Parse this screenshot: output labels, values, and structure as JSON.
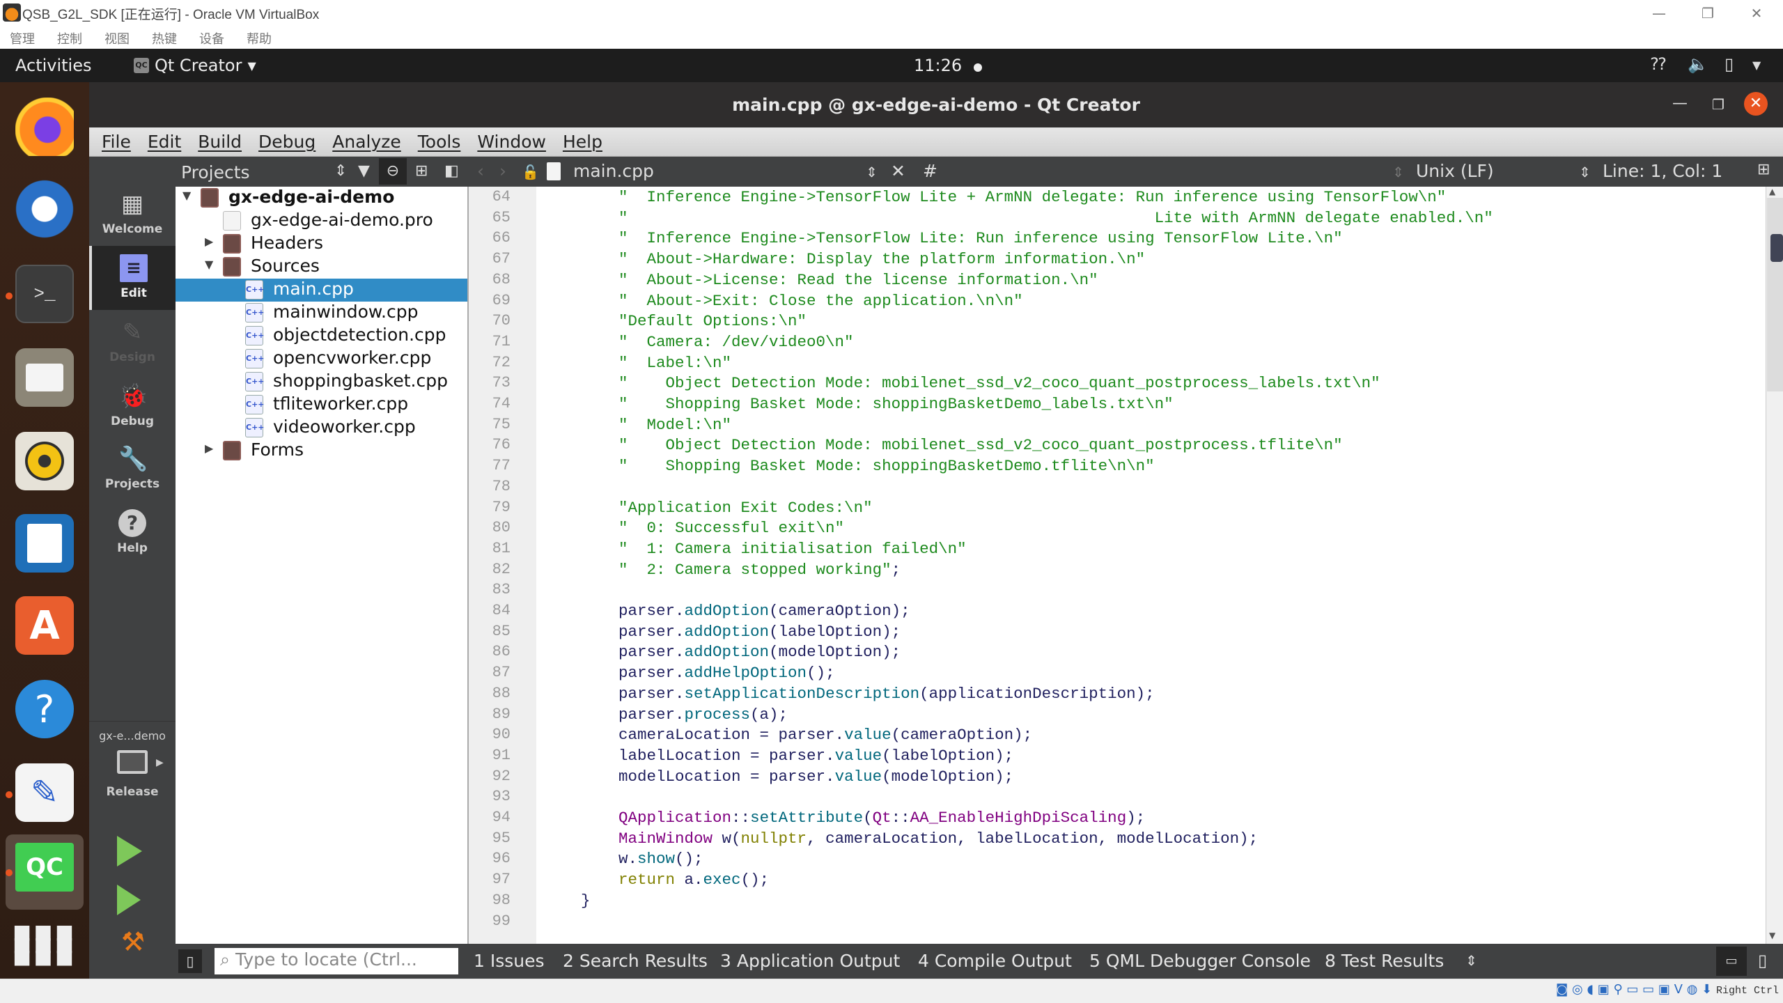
{
  "host": {
    "title": "QSB_G2L_SDK [正在运行] - Oracle VM VirtualBox",
    "menu": [
      "管理",
      "控制",
      "视图",
      "热键",
      "设备",
      "帮助"
    ],
    "host_key": "Right Ctrl"
  },
  "topbar": {
    "activities": "Activities",
    "app_name": "Qt Creator",
    "clock": "11:26"
  },
  "dock": {
    "apps": [
      {
        "name": "Firefox",
        "running": false
      },
      {
        "name": "Thunderbird",
        "running": false
      },
      {
        "name": "Terminal",
        "running": true
      },
      {
        "name": "Files",
        "running": false
      },
      {
        "name": "Rhythmbox",
        "running": false
      },
      {
        "name": "LibreOffice Writer",
        "running": false
      },
      {
        "name": "Ubuntu Software",
        "running": false
      },
      {
        "name": "Help",
        "running": false
      },
      {
        "name": "Text Editor",
        "running": true
      },
      {
        "name": "Qt Creator",
        "running": true
      }
    ]
  },
  "window": {
    "title": "main.cpp @ gx-edge-ai-demo - Qt Creator",
    "menu": [
      "File",
      "Edit",
      "Build",
      "Debug",
      "Analyze",
      "Tools",
      "Window",
      "Help"
    ]
  },
  "modes": [
    {
      "label": "Welcome",
      "state": "normal"
    },
    {
      "label": "Edit",
      "state": "active"
    },
    {
      "label": "Design",
      "state": "disabled"
    },
    {
      "label": "Debug",
      "state": "normal"
    },
    {
      "label": "Projects",
      "state": "normal"
    },
    {
      "label": "Help",
      "state": "normal"
    }
  ],
  "kit": {
    "project": "gx-e...demo",
    "build_config": "Release"
  },
  "projects": {
    "header": "Projects",
    "tree": [
      {
        "label": "gx-edge-ai-demo",
        "level": 0,
        "expanded": true,
        "type": "project"
      },
      {
        "label": "gx-edge-ai-demo.pro",
        "level": 1,
        "type": "pro"
      },
      {
        "label": "Headers",
        "level": 1,
        "expanded": false,
        "type": "folder-h"
      },
      {
        "label": "Sources",
        "level": 1,
        "expanded": true,
        "type": "folder-cpp"
      },
      {
        "label": "main.cpp",
        "level": 2,
        "type": "cpp",
        "selected": true
      },
      {
        "label": "mainwindow.cpp",
        "level": 2,
        "type": "cpp"
      },
      {
        "label": "objectdetection.cpp",
        "level": 2,
        "type": "cpp"
      },
      {
        "label": "opencvworker.cpp",
        "level": 2,
        "type": "cpp"
      },
      {
        "label": "shoppingbasket.cpp",
        "level": 2,
        "type": "cpp"
      },
      {
        "label": "tfliteworker.cpp",
        "level": 2,
        "type": "cpp"
      },
      {
        "label": "videoworker.cpp",
        "level": 2,
        "type": "cpp"
      },
      {
        "label": "Forms",
        "level": 1,
        "expanded": false,
        "type": "folder-ui"
      }
    ]
  },
  "editor": {
    "file": "main.cpp",
    "symbol": "#",
    "line_endings": "Unix (LF)",
    "cursor": "Line: 1, Col: 1",
    "lines": [
      {
        "n": 64,
        "parts": [
          [
            "str",
            "    \"  Inference Engine->TensorFlow Lite + ArmNN delegate: Run inference using TensorFlow\\n\""
          ]
        ]
      },
      {
        "n": 65,
        "parts": [
          [
            "str",
            "    \"                                                        Lite with ArmNN delegate enabled.\\n\""
          ]
        ]
      },
      {
        "n": 66,
        "parts": [
          [
            "str",
            "    \"  Inference Engine->TensorFlow Lite: Run inference using TensorFlow Lite.\\n\""
          ]
        ]
      },
      {
        "n": 67,
        "parts": [
          [
            "str",
            "    \"  About->Hardware: Display the platform information.\\n\""
          ]
        ]
      },
      {
        "n": 68,
        "parts": [
          [
            "str",
            "    \"  About->License: Read the license information.\\n\""
          ]
        ]
      },
      {
        "n": 69,
        "parts": [
          [
            "str",
            "    \"  About->Exit: Close the application.\\n\\n\""
          ]
        ]
      },
      {
        "n": 70,
        "parts": [
          [
            "str",
            "    \"Default Options:\\n\""
          ]
        ]
      },
      {
        "n": 71,
        "parts": [
          [
            "str",
            "    \"  Camera: /dev/video0\\n\""
          ]
        ]
      },
      {
        "n": 72,
        "parts": [
          [
            "str",
            "    \"  Label:\\n\""
          ]
        ]
      },
      {
        "n": 73,
        "parts": [
          [
            "str",
            "    \"    Object Detection Mode: mobilenet_ssd_v2_coco_quant_postprocess_labels.txt\\n\""
          ]
        ]
      },
      {
        "n": 74,
        "parts": [
          [
            "str",
            "    \"    Shopping Basket Mode: shoppingBasketDemo_labels.txt\\n\""
          ]
        ]
      },
      {
        "n": 75,
        "parts": [
          [
            "str",
            "    \"  Model:\\n\""
          ]
        ]
      },
      {
        "n": 76,
        "parts": [
          [
            "str",
            "    \"    Object Detection Mode: mobilenet_ssd_v2_coco_quant_postprocess.tflite\\n\""
          ]
        ]
      },
      {
        "n": 77,
        "parts": [
          [
            "str",
            "    \"    Shopping Basket Mode: shoppingBasketDemo.tflite\\n\\n\""
          ]
        ]
      },
      {
        "n": 78,
        "parts": []
      },
      {
        "n": 79,
        "parts": [
          [
            "str",
            "    \"Application Exit Codes:\\n\""
          ]
        ]
      },
      {
        "n": 80,
        "parts": [
          [
            "str",
            "    \"  0: Successful exit\\n\""
          ]
        ]
      },
      {
        "n": 81,
        "parts": [
          [
            "str",
            "    \"  1: Camera initialisation failed\\n\""
          ]
        ]
      },
      {
        "n": 82,
        "parts": [
          [
            "str",
            "    \"  2: Camera stopped working\""
          ],
          [
            "pl",
            ";"
          ]
        ]
      },
      {
        "n": 83,
        "parts": []
      },
      {
        "n": 84,
        "parts": [
          [
            "pl",
            "    parser."
          ],
          [
            "fn",
            "addOption"
          ],
          [
            "pl",
            "(cameraOption);"
          ]
        ]
      },
      {
        "n": 85,
        "parts": [
          [
            "pl",
            "    parser."
          ],
          [
            "fn",
            "addOption"
          ],
          [
            "pl",
            "(labelOption);"
          ]
        ]
      },
      {
        "n": 86,
        "parts": [
          [
            "pl",
            "    parser."
          ],
          [
            "fn",
            "addOption"
          ],
          [
            "pl",
            "(modelOption);"
          ]
        ]
      },
      {
        "n": 87,
        "parts": [
          [
            "pl",
            "    parser."
          ],
          [
            "fn",
            "addHelpOption"
          ],
          [
            "pl",
            "();"
          ]
        ]
      },
      {
        "n": 88,
        "parts": [
          [
            "pl",
            "    parser."
          ],
          [
            "fn",
            "setApplicationDescription"
          ],
          [
            "pl",
            "(applicationDescription);"
          ]
        ]
      },
      {
        "n": 89,
        "parts": [
          [
            "pl",
            "    parser."
          ],
          [
            "fn",
            "process"
          ],
          [
            "pl",
            "(a);"
          ]
        ]
      },
      {
        "n": 90,
        "parts": [
          [
            "pl",
            "    cameraLocation = parser."
          ],
          [
            "fn",
            "value"
          ],
          [
            "pl",
            "(cameraOption);"
          ]
        ]
      },
      {
        "n": 91,
        "parts": [
          [
            "pl",
            "    labelLocation = parser."
          ],
          [
            "fn",
            "value"
          ],
          [
            "pl",
            "(labelOption);"
          ]
        ]
      },
      {
        "n": 92,
        "parts": [
          [
            "pl",
            "    modelLocation = parser."
          ],
          [
            "fn",
            "value"
          ],
          [
            "pl",
            "(modelOption);"
          ]
        ]
      },
      {
        "n": 93,
        "parts": []
      },
      {
        "n": 94,
        "parts": [
          [
            "typ",
            "    QApplication"
          ],
          [
            "pl",
            "::"
          ],
          [
            "fn",
            "setAttribute"
          ],
          [
            "pl",
            "("
          ],
          [
            "typ",
            "Qt"
          ],
          [
            "pl",
            "::"
          ],
          [
            "typ",
            "AA_EnableHighDpiScaling"
          ],
          [
            "pl",
            ");"
          ]
        ]
      },
      {
        "n": 95,
        "parts": [
          [
            "typ",
            "    MainWindow"
          ],
          [
            "pl",
            " w("
          ],
          [
            "kw",
            "nullptr"
          ],
          [
            "pl",
            ", cameraLocation, labelLocation, modelLocation);"
          ]
        ]
      },
      {
        "n": 96,
        "parts": [
          [
            "pl",
            "    w."
          ],
          [
            "fn",
            "show"
          ],
          [
            "pl",
            "();"
          ]
        ]
      },
      {
        "n": 97,
        "parts": [
          [
            "kw",
            "    return"
          ],
          [
            "pl",
            " a."
          ],
          [
            "fn",
            "exec"
          ],
          [
            "pl",
            "();"
          ]
        ]
      },
      {
        "n": 98,
        "parts": [
          [
            "pl",
            "}"
          ]
        ]
      },
      {
        "n": 99,
        "parts": []
      }
    ]
  },
  "output": {
    "locator_placeholder": "Type to locate (Ctrl...",
    "tabs": [
      "1  Issues",
      "2  Search Results",
      "3  Application Output",
      "4  Compile Output",
      "5  QML Debugger Console",
      "8  Test Results"
    ]
  },
  "colors": {
    "selection": "#308cc6",
    "ubuntu_orange": "#e95420",
    "string": "#1d8a1d",
    "function": "#00677c",
    "type": "#800080",
    "keyword": "#808000"
  }
}
